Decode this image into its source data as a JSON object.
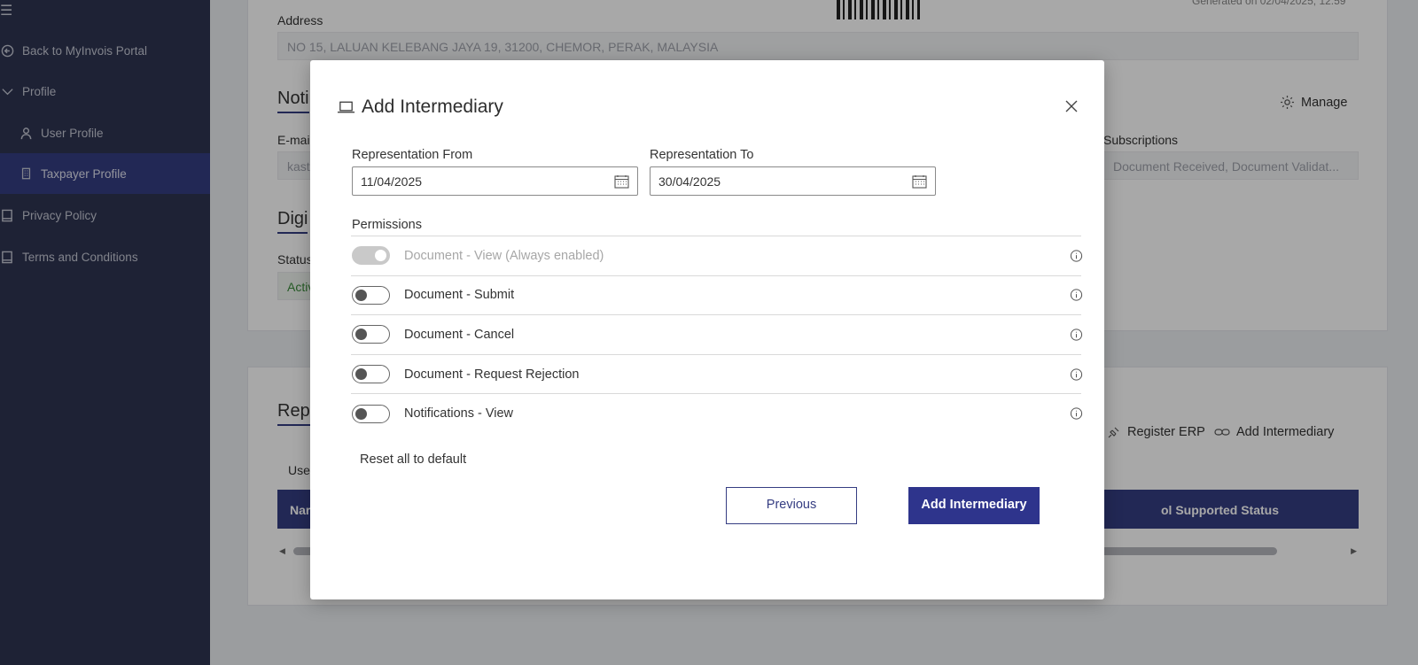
{
  "sidebar": {
    "items": [
      {
        "label": "Back to MyInvois Portal",
        "icon": "arrow-left-circle-icon"
      },
      {
        "label": "Profile",
        "icon": "chevron-down-icon"
      },
      {
        "label": "User Profile",
        "icon": "user-icon"
      },
      {
        "label": "Taxpayer Profile",
        "icon": "building-icon"
      },
      {
        "label": "Privacy Policy",
        "icon": "book-icon"
      },
      {
        "label": "Terms and Conditions",
        "icon": "book-icon"
      }
    ]
  },
  "background": {
    "generated_text": "Generated on 02/04/2025, 12:59",
    "address_label": "Address",
    "address_value": "NO 15, LALUAN KELEBANG JAYA 19, 31200, CHEMOR, PERAK, MALAYSIA",
    "notifications_heading": "Noti",
    "email_label": "E-mai",
    "email_value": "kast",
    "manage_label": "Manage",
    "subscriptions_label": "Subscriptions",
    "subscriptions_value": "Document Received, Document Validat...",
    "digital_heading": "Digi",
    "status_label": "Status",
    "status_value": "Activ",
    "rep_heading": "Rep",
    "use_tab": "Use",
    "register_erp": "Register ERP",
    "add_intermediary_link": "Add Intermediary",
    "table_col_name": "Nar",
    "table_col_status": "ol Supported Status"
  },
  "modal": {
    "title": "Add Intermediary",
    "representation_from_label": "Representation From",
    "representation_from_value": "11/04/2025",
    "representation_to_label": "Representation To",
    "representation_to_value": "30/04/2025",
    "permissions_label": "Permissions",
    "permissions": [
      {
        "label": "Document - View (Always enabled)",
        "enabled": true,
        "disabled": true
      },
      {
        "label": "Document - Submit",
        "enabled": false,
        "disabled": false
      },
      {
        "label": "Document - Cancel",
        "enabled": false,
        "disabled": false
      },
      {
        "label": "Document - Request Rejection",
        "enabled": false,
        "disabled": false
      },
      {
        "label": "Notifications - View",
        "enabled": false,
        "disabled": false
      }
    ],
    "reset_label": "Reset all to default",
    "previous_label": "Previous",
    "add_label": "Add Intermediary"
  },
  "colors": {
    "sidebar_bg": "#2e3451",
    "accent": "#353d82",
    "primary_button": "#2e348c"
  }
}
